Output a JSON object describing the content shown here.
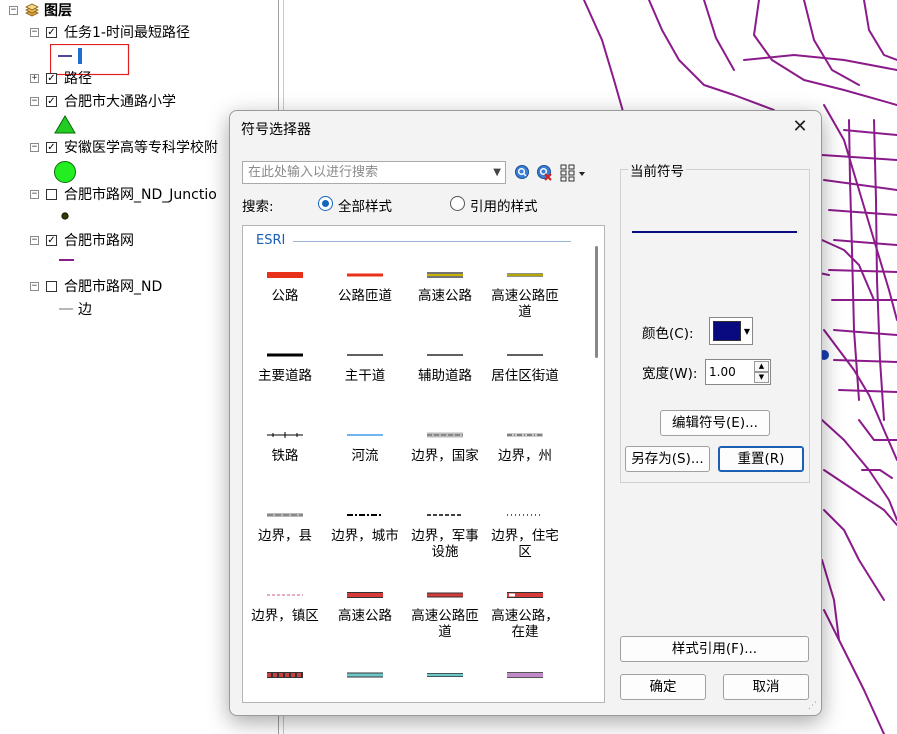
{
  "toc": {
    "root_label": "图层",
    "layers": [
      {
        "name": "任务1-时间最短路径",
        "checked": true,
        "expander": "⊟"
      },
      {
        "name": "路径",
        "checked": true,
        "expander": "⊞"
      },
      {
        "name": "合肥市大通路小学",
        "checked": true,
        "expander": "⊟"
      },
      {
        "name": "安徽医学高等专科学校附",
        "checked": true,
        "expander": "⊟"
      },
      {
        "name": "合肥市路网_ND_Junctio",
        "checked": false,
        "expander": "⊟"
      },
      {
        "name": "合肥市路网",
        "checked": true,
        "expander": "⊟"
      },
      {
        "name": "合肥市路网_ND",
        "checked": false,
        "expander": "⊟"
      }
    ],
    "edge_label": "边",
    "check_mark": "✓"
  },
  "dialog": {
    "title": "符号选择器",
    "close_glyph": "✕",
    "search_placeholder": "在此处输入以进行搜索",
    "search_label": "搜索:",
    "radio_all": "全部样式",
    "radio_referenced": "引用的样式",
    "gallery_header": "ESRI",
    "symbols": [
      {
        "label": "公路",
        "color": "#e8311a",
        "style": "thick"
      },
      {
        "label": "公路匝道",
        "color": "#e8311a",
        "style": "medium"
      },
      {
        "label": "高速公路",
        "color": "#c8b400",
        "style": "double"
      },
      {
        "label": "高速公路匝\n道",
        "color": "#e6d200",
        "style": "yellowthin"
      },
      {
        "label": "主要道路",
        "color": "#000000",
        "style": "medium"
      },
      {
        "label": "主干道",
        "color": "#000000",
        "style": "thin"
      },
      {
        "label": "辅助道路",
        "color": "#000000",
        "style": "thin"
      },
      {
        "label": "居住区街道",
        "color": "#000000",
        "style": "thin"
      },
      {
        "label": "铁路",
        "color": "#000000",
        "style": "rail"
      },
      {
        "label": "河流",
        "color": "#1e88e5",
        "style": "thin"
      },
      {
        "label": "边界，国家",
        "color": "#888888",
        "style": "dashgray"
      },
      {
        "label": "边界，州",
        "color": "#666666",
        "style": "dashdot"
      },
      {
        "label": "边界，县",
        "color": "#777777",
        "style": "dashgray2"
      },
      {
        "label": "边界，城市",
        "color": "#000000",
        "style": "dashdotblack"
      },
      {
        "label": "边界，军事\n设施",
        "color": "#000000",
        "style": "dashblack"
      },
      {
        "label": "边界，住宅\n区",
        "color": "#000000",
        "style": "dotblack"
      },
      {
        "label": "边界，镇区",
        "color": "#d87ca0",
        "style": "dashpink"
      },
      {
        "label": "高速公路",
        "color": "#d63b3b",
        "style": "redcase"
      },
      {
        "label": "高速公路匝\n道",
        "color": "#d63b3b",
        "style": "redcase2"
      },
      {
        "label": "高速公路，\n在建",
        "color": "#d63b3b",
        "style": "redhollow"
      },
      {
        "label": "",
        "color": "#c94040",
        "style": "reddash"
      },
      {
        "label": "",
        "color": "#6fc8c8",
        "style": "teal"
      },
      {
        "label": "",
        "color": "#6fc8c8",
        "style": "teal2"
      },
      {
        "label": "",
        "color": "#c08ac8",
        "style": "purple"
      }
    ],
    "current_symbol_title": "当前符号",
    "current_color": "#0a0a80",
    "color_label": "颜色(C):",
    "width_label": "宽度(W):",
    "width_value": "1.00",
    "edit_symbol_label": "编辑符号(E)...",
    "save_as_label": "另存为(S)...",
    "reset_label": "重置(R)",
    "style_ref_label": "样式引用(F)...",
    "ok_label": "确定",
    "cancel_label": "取消"
  },
  "map": {
    "road_color": "#8b1a8b"
  }
}
